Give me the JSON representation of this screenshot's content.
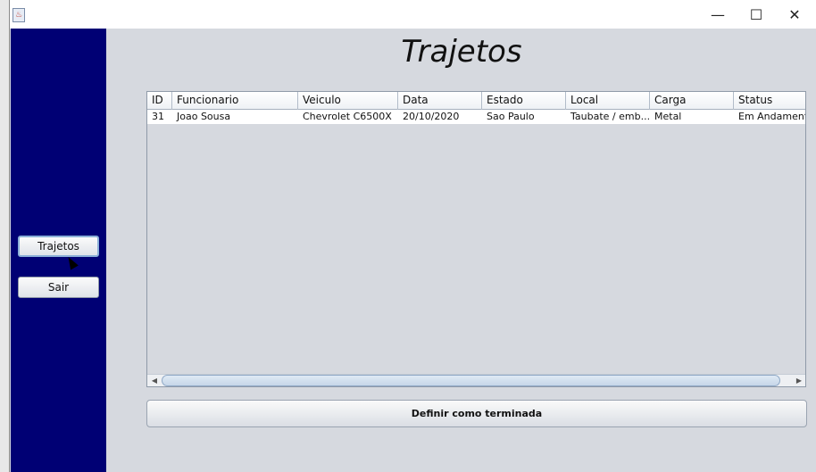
{
  "window": {
    "app_icon": "java-icon",
    "controls": {
      "minimize": "—",
      "maximize": "☐",
      "close": "✕"
    }
  },
  "sidebar": {
    "buttons": [
      {
        "label": "Trajetos"
      },
      {
        "label": "Sair"
      }
    ]
  },
  "main": {
    "title": "Trajetos",
    "table": {
      "columns": [
        "ID",
        "Funcionario",
        "Veiculo",
        "Data",
        "Estado",
        "Local",
        "Carga",
        "Status"
      ],
      "rows": [
        [
          "31",
          "Joao Sousa",
          "Chevrolet C6500X",
          "20/10/2020",
          "Sao Paulo",
          "Taubate / emb...",
          "Metal",
          "Em Andamento"
        ]
      ]
    },
    "scrollbar": {
      "left_arrow": "◀",
      "right_arrow": "▶"
    },
    "action_button": "Definir como terminada"
  },
  "colors": {
    "sidebar": "#000074",
    "background": "#d6d9df"
  }
}
